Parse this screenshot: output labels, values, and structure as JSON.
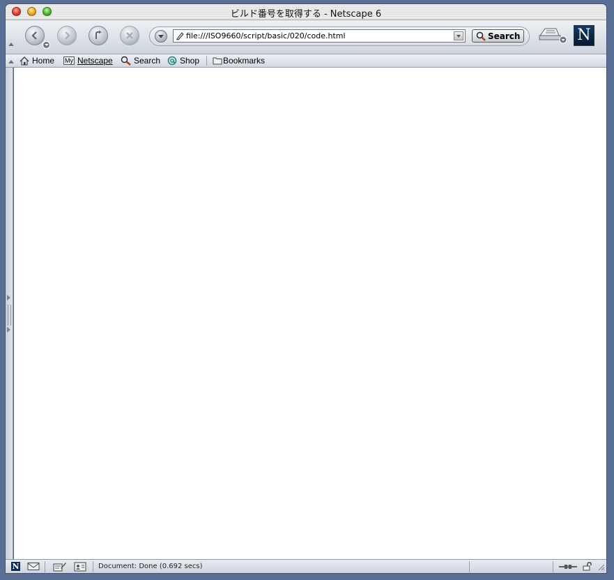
{
  "window": {
    "title": "ビルド番号を取得する - Netscape 6"
  },
  "navbar": {
    "back_icon": "back-arrow-icon",
    "forward_icon": "forward-arrow-icon",
    "reload_icon": "reload-icon",
    "stop_icon": "stop-icon",
    "url": "file:///ISO9660/script/basic/020/code.html",
    "search_label": "Search"
  },
  "personal_toolbar": {
    "items": [
      {
        "label": "Home",
        "icon": "home-icon"
      },
      {
        "label": "Netscape",
        "prefix": "My",
        "icon": "my-netscape-icon"
      },
      {
        "label": "Search",
        "icon": "search-icon"
      },
      {
        "label": "Shop",
        "icon": "shop-icon"
      },
      {
        "label": "Bookmarks",
        "icon": "folder-icon"
      }
    ]
  },
  "statusbar": {
    "text": "Document: Done (0.692 secs)"
  },
  "colors": {
    "desktop": "#5a6f96",
    "chrome": "#dfe3ea",
    "content": "#ffffff"
  }
}
